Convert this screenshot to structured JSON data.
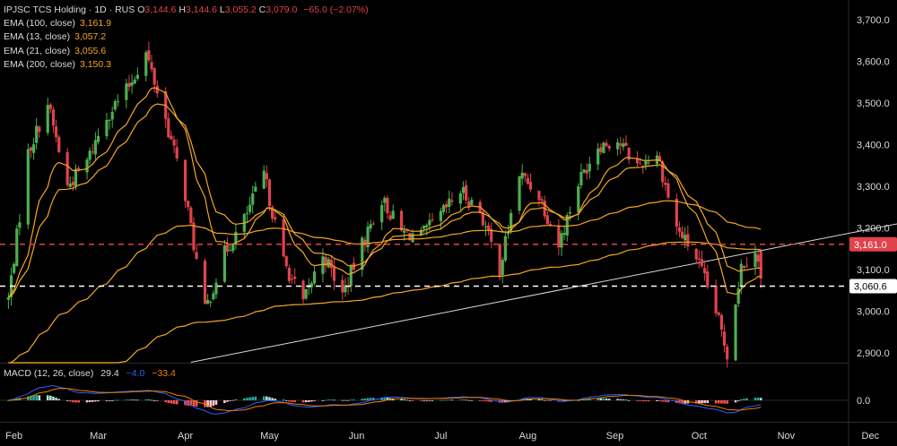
{
  "header": {
    "symbol": "IPJSC TCS Holding · 1D · RUS",
    "ohlc": [
      {
        "key": "O",
        "value": "3,144.6"
      },
      {
        "key": "H",
        "value": "3,144.6"
      },
      {
        "key": "L",
        "value": "3,055.2"
      },
      {
        "key": "C",
        "value": "3,079.0"
      }
    ],
    "change": "−65.0 (−2.07%)"
  },
  "indicators": [
    {
      "label": "EMA (100, close)",
      "value": "3,161.9",
      "color": "#f5a623"
    },
    {
      "label": "EMA (13, close)",
      "value": "3,057.2",
      "color": "#f5a623"
    },
    {
      "label": "EMA (21, close)",
      "value": "3,055.6",
      "color": "#f5a623"
    },
    {
      "label": "EMA (200, close)",
      "value": "3,150.3",
      "color": "#f5a623"
    }
  ],
  "macd_legend": {
    "label": "MACD (12, 26, close)",
    "macd": "29.4",
    "signal": "−4.0",
    "hist": "−33.4"
  },
  "price_tags": [
    {
      "label": "3,161.0",
      "color": "#e0434b",
      "line": "dashed-red"
    },
    {
      "label": "3,060.6",
      "color": "#ffffff",
      "line": "dashed-white"
    }
  ],
  "macd_axis_label": "0.0",
  "colors": {
    "up": "#4caf50",
    "down": "#e0434b",
    "ema": "#f5a623",
    "trendline": "#d9d9d9",
    "macd_line": "#2962ff",
    "signal_line": "#f57c00"
  },
  "chart_data": {
    "type": "candlestick",
    "x_ticks": [
      "Feb",
      "Mar",
      "Apr",
      "May",
      "Jun",
      "Jul",
      "Aug",
      "Sep",
      "Oct",
      "Nov",
      "Dec"
    ],
    "y_ticks": [
      "2,900.0",
      "3,000.0",
      "3,100.0",
      "3,200.0",
      "3,300.0",
      "3,400.0",
      "3,500.0",
      "3,600.0",
      "3,700.0"
    ],
    "ylim": [
      2860,
      3730
    ],
    "anchors": [
      {
        "date": "2024-01-29",
        "price": 3030
      },
      {
        "date": "2024-02-05",
        "price": 3380
      },
      {
        "date": "2024-02-12",
        "price": 3500
      },
      {
        "date": "2024-02-19",
        "price": 3300
      },
      {
        "date": "2024-02-26",
        "price": 3360
      },
      {
        "date": "2024-03-04",
        "price": 3470
      },
      {
        "date": "2024-03-11",
        "price": 3530
      },
      {
        "date": "2024-03-18",
        "price": 3620
      },
      {
        "date": "2024-03-25",
        "price": 3460
      },
      {
        "date": "2024-04-01",
        "price": 3280
      },
      {
        "date": "2024-04-08",
        "price": 3000
      },
      {
        "date": "2024-04-15",
        "price": 3140
      },
      {
        "date": "2024-04-22",
        "price": 3220
      },
      {
        "date": "2024-04-29",
        "price": 3330
      },
      {
        "date": "2024-05-06",
        "price": 3120
      },
      {
        "date": "2024-05-13",
        "price": 3020
      },
      {
        "date": "2024-05-20",
        "price": 3140
      },
      {
        "date": "2024-05-27",
        "price": 3040
      },
      {
        "date": "2024-06-03",
        "price": 3160
      },
      {
        "date": "2024-06-10",
        "price": 3270
      },
      {
        "date": "2024-06-17",
        "price": 3190
      },
      {
        "date": "2024-06-24",
        "price": 3180
      },
      {
        "date": "2024-07-01",
        "price": 3230
      },
      {
        "date": "2024-07-08",
        "price": 3290
      },
      {
        "date": "2024-07-15",
        "price": 3240
      },
      {
        "date": "2024-07-22",
        "price": 3100
      },
      {
        "date": "2024-07-29",
        "price": 3330
      },
      {
        "date": "2024-08-05",
        "price": 3280
      },
      {
        "date": "2024-08-12",
        "price": 3160
      },
      {
        "date": "2024-08-19",
        "price": 3310
      },
      {
        "date": "2024-08-26",
        "price": 3400
      },
      {
        "date": "2024-09-02",
        "price": 3410
      },
      {
        "date": "2024-09-09",
        "price": 3350
      },
      {
        "date": "2024-09-16",
        "price": 3380
      },
      {
        "date": "2024-09-23",
        "price": 3200
      },
      {
        "date": "2024-09-30",
        "price": 3130
      },
      {
        "date": "2024-10-07",
        "price": 3000
      },
      {
        "date": "2024-10-11",
        "price": 2900
      },
      {
        "date": "2024-10-16",
        "price": 3110
      },
      {
        "date": "2024-10-21",
        "price": 3150
      },
      {
        "date": "2024-10-23",
        "price": 3079
      }
    ],
    "ema_series": [
      {
        "name": "EMA (13, close)",
        "span": 13
      },
      {
        "name": "EMA (21, close)",
        "span": 21
      },
      {
        "name": "EMA (100, close)",
        "span": 100
      },
      {
        "name": "EMA (200, close)",
        "span": 200
      }
    ],
    "trendline": {
      "from": {
        "date": "2024-04-03",
        "price": 2878
      },
      "to": {
        "date": "2024-12-12",
        "price": 3212
      }
    },
    "hlines": [
      3161.0,
      3060.6
    ],
    "macd_series": [
      {
        "name": "MACD (12, 26, close)",
        "fast": 12,
        "slow": 26,
        "signal": 9
      }
    ]
  }
}
